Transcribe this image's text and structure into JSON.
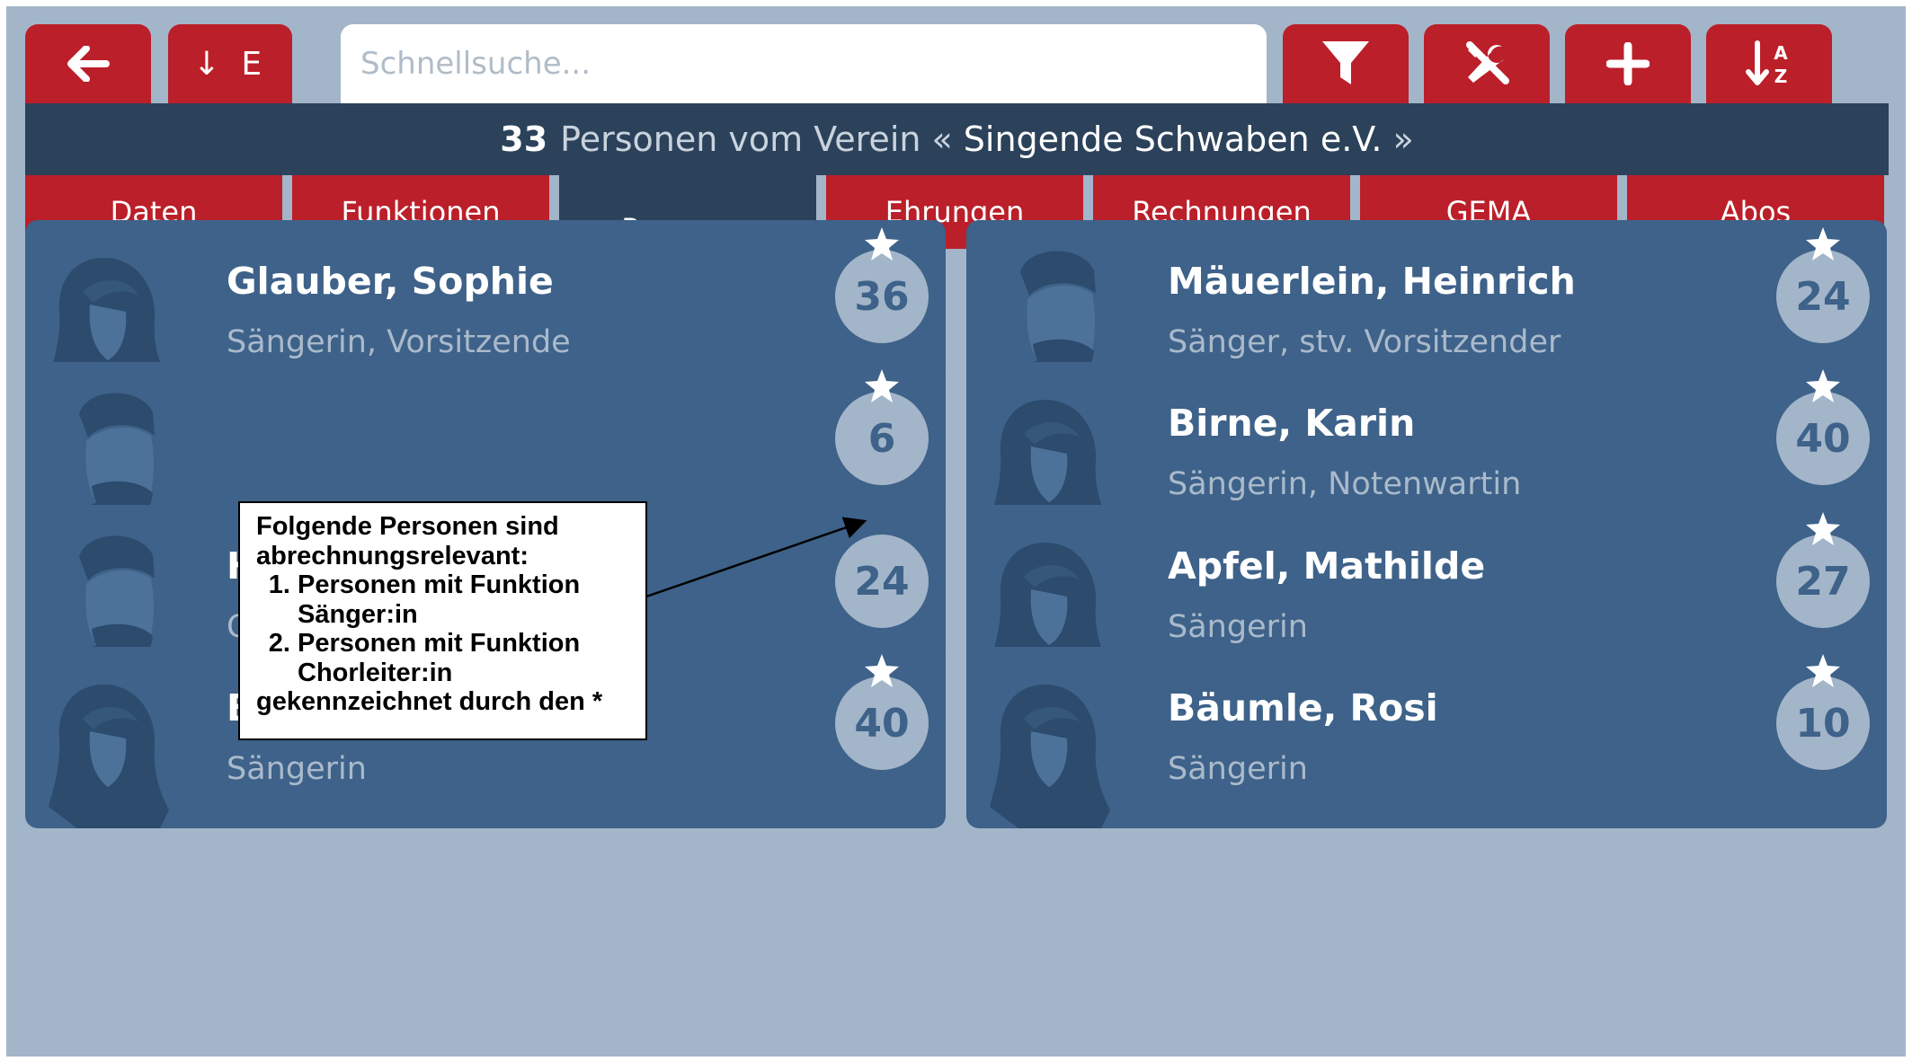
{
  "toolbar": {
    "back_icon": "arrow-left-icon",
    "sort_direction_label": "↓ E",
    "search_placeholder": "Schnellsuche...",
    "filter_icon": "filter-icon",
    "tools_icon": "tools-icon",
    "add_icon": "plus-icon",
    "sort_icon": "sort-alpha-icon"
  },
  "titlebar": {
    "count": "33",
    "prefix": "Personen vom Verein «",
    "club": "Singende Schwaben e.V.",
    "suffix": "»"
  },
  "tabs": [
    {
      "label": "Daten",
      "active": false
    },
    {
      "label": "Funktionen",
      "active": false
    },
    {
      "label": "Personen",
      "active": true
    },
    {
      "label": "Ehrungen",
      "active": false
    },
    {
      "label": "Rechnungen",
      "active": false
    },
    {
      "label": "GEMA",
      "active": false
    },
    {
      "label": "Abos",
      "active": false
    }
  ],
  "persons": [
    {
      "name": "Glauber, Sophie",
      "role": "Sängerin, Vorsitzende",
      "years": "36",
      "starred": true,
      "avatar": "female-avatar-icon"
    },
    {
      "name": "Mäuerlein, Heinrich",
      "role": "Sänger, stv. Vorsitzender",
      "years": "24",
      "starred": true,
      "avatar": "male-avatar-icon"
    },
    {
      "name": "",
      "role": "",
      "years": "6",
      "starred": true,
      "avatar": "male-avatar-icon"
    },
    {
      "name": "Birne, Karin",
      "role": "Sängerin, Notenwartin",
      "years": "40",
      "starred": true,
      "avatar": "female-avatar-icon"
    },
    {
      "name": "Hopfensitz, Josef",
      "role": "Chorleiter",
      "years": "24",
      "starred": false,
      "avatar": "male-avatar-icon"
    },
    {
      "name": "Apfel, Mathilde",
      "role": "Sängerin",
      "years": "27",
      "starred": true,
      "avatar": "female-avatar-icon"
    },
    {
      "name": "Bauer, Karoline",
      "role": "Sängerin",
      "years": "40",
      "starred": true,
      "avatar": "female-avatar-icon"
    },
    {
      "name": "Bäumle, Rosi",
      "role": "Sängerin",
      "years": "10",
      "starred": true,
      "avatar": "female-avatar-icon"
    }
  ],
  "annotation": {
    "intro": "Folgende Personen sind abrechnungsrelevant:",
    "items": [
      "Personen mit Funktion Sänger:in",
      "Personen mit Funktion Chorleiter:in"
    ],
    "outro": "gekennzeichnet durch den *"
  },
  "colors": {
    "accent_red": "#bb1f29",
    "navy": "#2b425a",
    "card": "#3e6289",
    "background": "#a3b5c9"
  }
}
